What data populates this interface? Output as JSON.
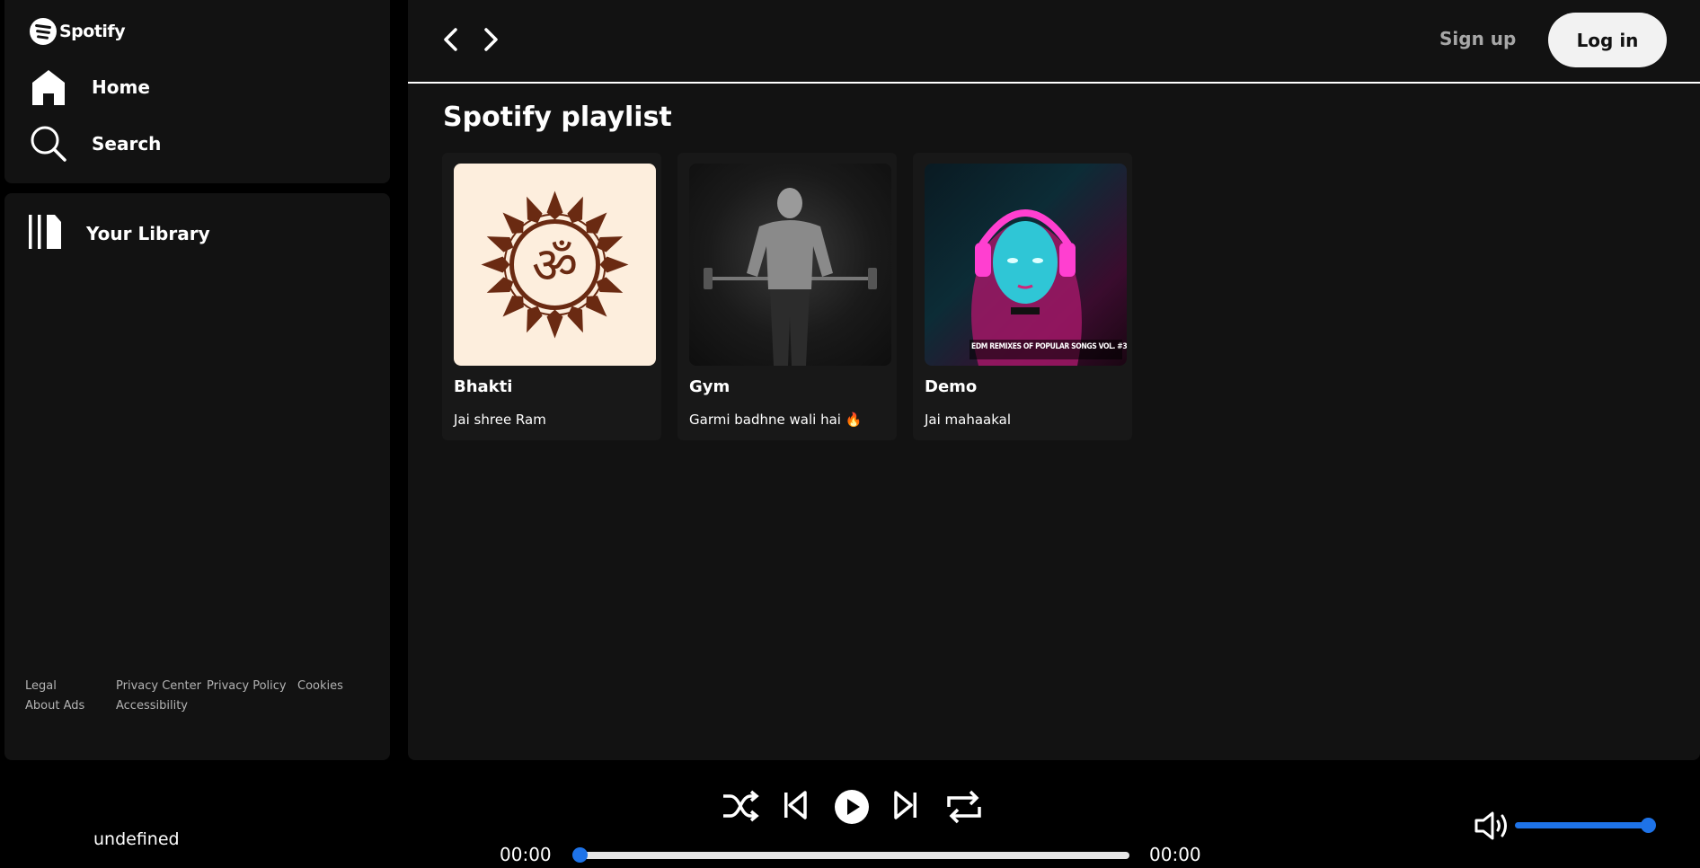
{
  "brand": {
    "name": "Spotify"
  },
  "nav": {
    "home_label": "Home",
    "search_label": "Search",
    "library_label": "Your Library"
  },
  "footer_links": [
    "Legal",
    "Privacy Center",
    "Privacy Policy",
    "Cookies",
    "About Ads",
    "Accessibility"
  ],
  "header": {
    "signup_label": "Sign up",
    "login_label": "Log in"
  },
  "main": {
    "section_title": "Spotify playlist",
    "cards": [
      {
        "title": "Bhakti",
        "subtitle": "Jai shree Ram",
        "cover_icon": "om-mandala-cover"
      },
      {
        "title": "Gym",
        "subtitle": "Garmi badhne wali hai 🔥",
        "cover_icon": "gym-cover"
      },
      {
        "title": "Demo",
        "subtitle": "Jai mahaakal",
        "cover_icon": "headphones-girl-cover",
        "cover_text": "EDM REMIXES OF POPULAR SONGS VOL. #3"
      }
    ]
  },
  "player": {
    "now_playing": "undefined",
    "current_time": "00:00",
    "duration": "00:00",
    "progress": 0,
    "volume": 1.0,
    "accent_color": "#1e73e8"
  }
}
